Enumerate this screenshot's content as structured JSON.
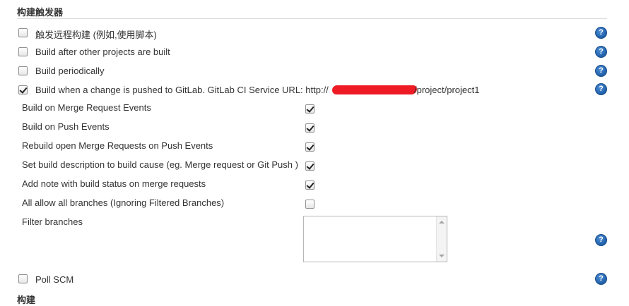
{
  "section": {
    "title": "构建触发器",
    "next_title": "构建"
  },
  "triggers": {
    "remote": {
      "label": "触发远程构建 (例如,使用脚本)",
      "checked": false
    },
    "after_other": {
      "label": "Build after other projects are built",
      "checked": false
    },
    "periodically": {
      "label": "Build periodically",
      "checked": false
    },
    "gitlab": {
      "label": "Build when a change is pushed to GitLab. GitLab CI Service URL: http://",
      "url_suffix": "/project/project1",
      "checked": true
    },
    "poll_scm": {
      "label": "Poll SCM",
      "checked": false
    }
  },
  "gitlab_options": [
    {
      "label": "Build on Merge Request Events",
      "checked": true
    },
    {
      "label": "Build on Push Events",
      "checked": true
    },
    {
      "label": "Rebuild open Merge Requests on Push Events",
      "checked": true
    },
    {
      "label": "Set build description to build cause (eg. Merge request or Git Push )",
      "checked": true
    },
    {
      "label": "Add note with build status on merge requests",
      "checked": true
    },
    {
      "label": "All allow all branches (Ignoring Filtered Branches)",
      "checked": false
    }
  ],
  "filter": {
    "label": "Filter branches",
    "value": ""
  },
  "help": {
    "glyph": "?"
  },
  "colors": {
    "help_blue": "#1f5fa8",
    "redaction_red": "#ee1b24"
  }
}
